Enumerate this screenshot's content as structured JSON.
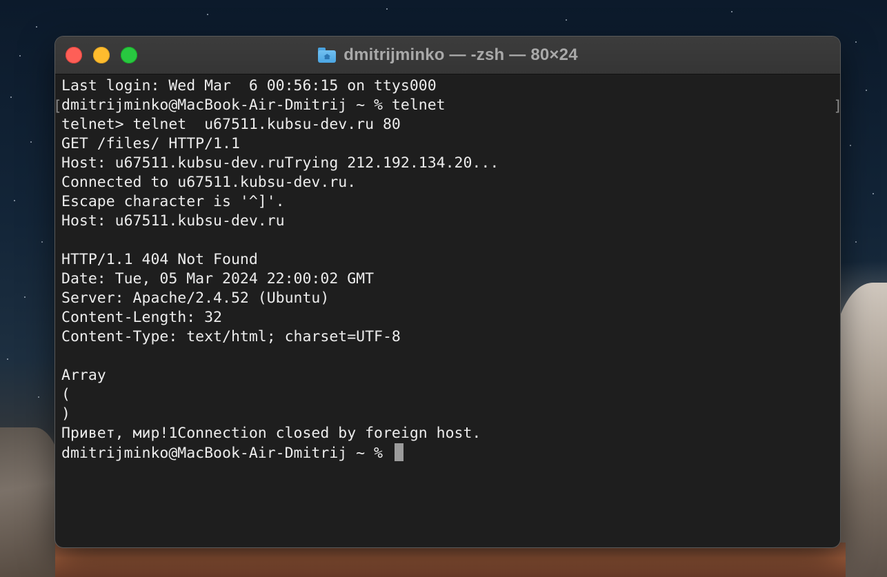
{
  "window": {
    "title": "dmitrijminko — -zsh — 80×24",
    "title_icon": "home-folder-icon"
  },
  "terminal": {
    "lines": [
      "Last login: Wed Mar  6 00:56:15 on ttys000",
      "dmitrijminko@MacBook-Air-Dmitrij ~ % telnet",
      "telnet> telnet  u67511.kubsu-dev.ru 80",
      "GET /files/ HTTP/1.1",
      "Host: u67511.kubsu-dev.ruTrying 212.192.134.20...",
      "Connected to u67511.kubsu-dev.ru.",
      "Escape character is '^]'.",
      "Host: u67511.kubsu-dev.ru",
      "",
      "HTTP/1.1 404 Not Found",
      "Date: Tue, 05 Mar 2024 22:00:02 GMT",
      "Server: Apache/2.4.52 (Ubuntu)",
      "Content-Length: 32",
      "Content-Type: text/html; charset=UTF-8",
      "",
      "Array",
      "(",
      ")",
      "Привет, мир!1Connection closed by foreign host.",
      "dmitrijminko@MacBook-Air-Dmitrij ~ % "
    ],
    "mark_left": "[",
    "mark_right": "]"
  },
  "colors": {
    "close": "#fe5f57",
    "minimize": "#febc2e",
    "maximize": "#28c840",
    "terminal_bg": "#1e1e1e",
    "terminal_fg": "#ececec"
  }
}
